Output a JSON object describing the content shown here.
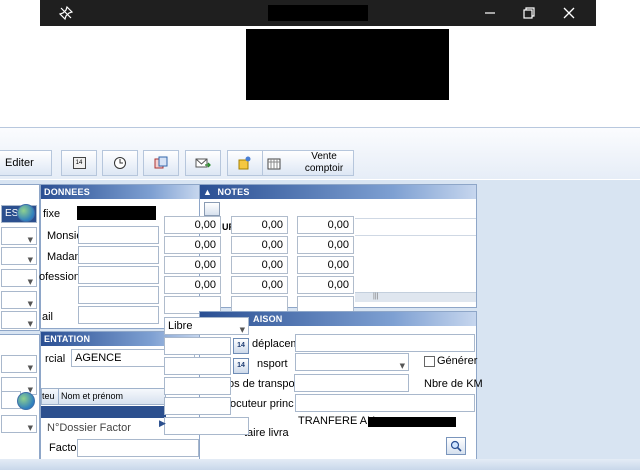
{
  "titlebar": {
    "controls": [
      "minimize",
      "restore",
      "close"
    ]
  },
  "toolbar": {
    "edit_label": "Editer",
    "vente_comptoir_label": "Vente comptoir"
  },
  "left_panel": {
    "upper_combos": [
      "",
      "",
      "",
      "",
      ""
    ],
    "tab_label": "ES",
    "lower_combos": [
      "",
      ""
    ],
    "bottom_row_fragment": "teu"
  },
  "donnees": {
    "header": "DONNEES",
    "labels": [
      "fixe",
      "Monsie",
      "Madan",
      "ofessionn",
      "",
      "ail"
    ]
  },
  "notes": {
    "header": "NOTES",
    "grid": [
      [
        "0,00",
        "0,00",
        "0,00"
      ],
      [
        "0,00",
        "0,00",
        "0,00"
      ],
      [
        "0,00",
        "0,00",
        "0,00"
      ],
      [
        "0,00",
        "0,00",
        "0,00"
      ]
    ],
    "col_header_fragment": "UF"
  },
  "orientation": {
    "header": "ENTATION",
    "commercial_label": "rcial",
    "commercial_value": "AGENCE",
    "nom_prenom_header": "Nom et prénom",
    "dossier_label": "N°Dossier Factor",
    "factor_label": "Factor"
  },
  "livraison": {
    "header": "AISON",
    "type_value": "Libre",
    "deplacement_label": "déplacem",
    "transport_label": "nsport",
    "generer_label": "Générer",
    "frais_transport_label": "os de transpo",
    "nbre_km_label": "Nbre de KM",
    "interlocuteur_label": "ocuteur princ",
    "commentaire_label": "taire livra",
    "commentaire_value": "TRANFERE AU"
  },
  "colors": {
    "panel_header_start": "#2a4f93",
    "panel_header_end": "#c6d6ee",
    "workarea": "#d8e4f2",
    "titlebar": "#1f1f1f"
  }
}
